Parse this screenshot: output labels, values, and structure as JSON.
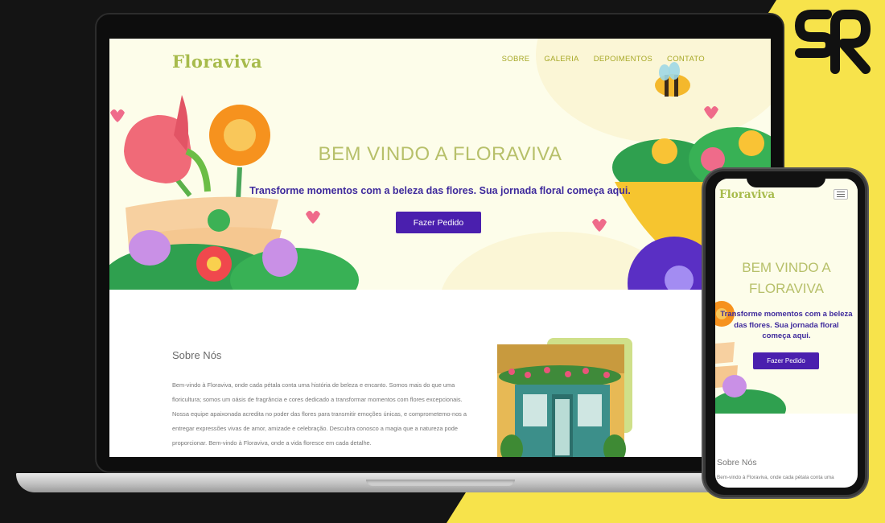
{
  "colors": {
    "accent_yellow": "#f7e34b",
    "hero_bg": "#fdfdea",
    "brand_green": "#a7bb4c",
    "cta_purple": "#4a1fae",
    "subtitle_purple": "#3e2a9c"
  },
  "corner_logo": {
    "icon": "sr-monogram-icon"
  },
  "site": {
    "brand": "Floraviva",
    "nav": [
      "SOBRE",
      "GALERIA",
      "DEPOIMENTOS",
      "CONTATO"
    ],
    "hero_title": "BEM VINDO A FLORAVIVA",
    "hero_subtitle": "Transforme momentos com a beleza das flores. Sua jornada floral começa aqui.",
    "cta_label": "Fazer Pedido",
    "about_title": "Sobre Nós",
    "about_text": "Bem-vindo à Floraviva, onde cada pétala conta uma história de beleza e encanto. Somos mais do que uma floricultura; somos um oásis de fragrância e cores dedicado a transformar momentos com flores excepcionais. Nossa equipe apaixonada acredita no poder das flores para transmitir emoções únicas, e comprometemo-nos a entregar expressões vivas de amor, amizade e celebração. Descubra conosco a magia que a natureza pode proporcionar. Bem-vindo à Floraviva, onde a vida floresce em cada detalhe."
  },
  "mobile": {
    "brand": "Floraviva",
    "menu_icon": "hamburger-menu-icon",
    "hero_title": "BEM VINDO A FLORAVIVA",
    "hero_subtitle": "Transforme momentos com a beleza das flores. Sua jornada floral começa aqui.",
    "cta_label": "Fazer Pedido",
    "about_title": "Sobre Nós",
    "about_text": "Bem-vindo à Floraviva, onde cada pétala conta uma"
  }
}
